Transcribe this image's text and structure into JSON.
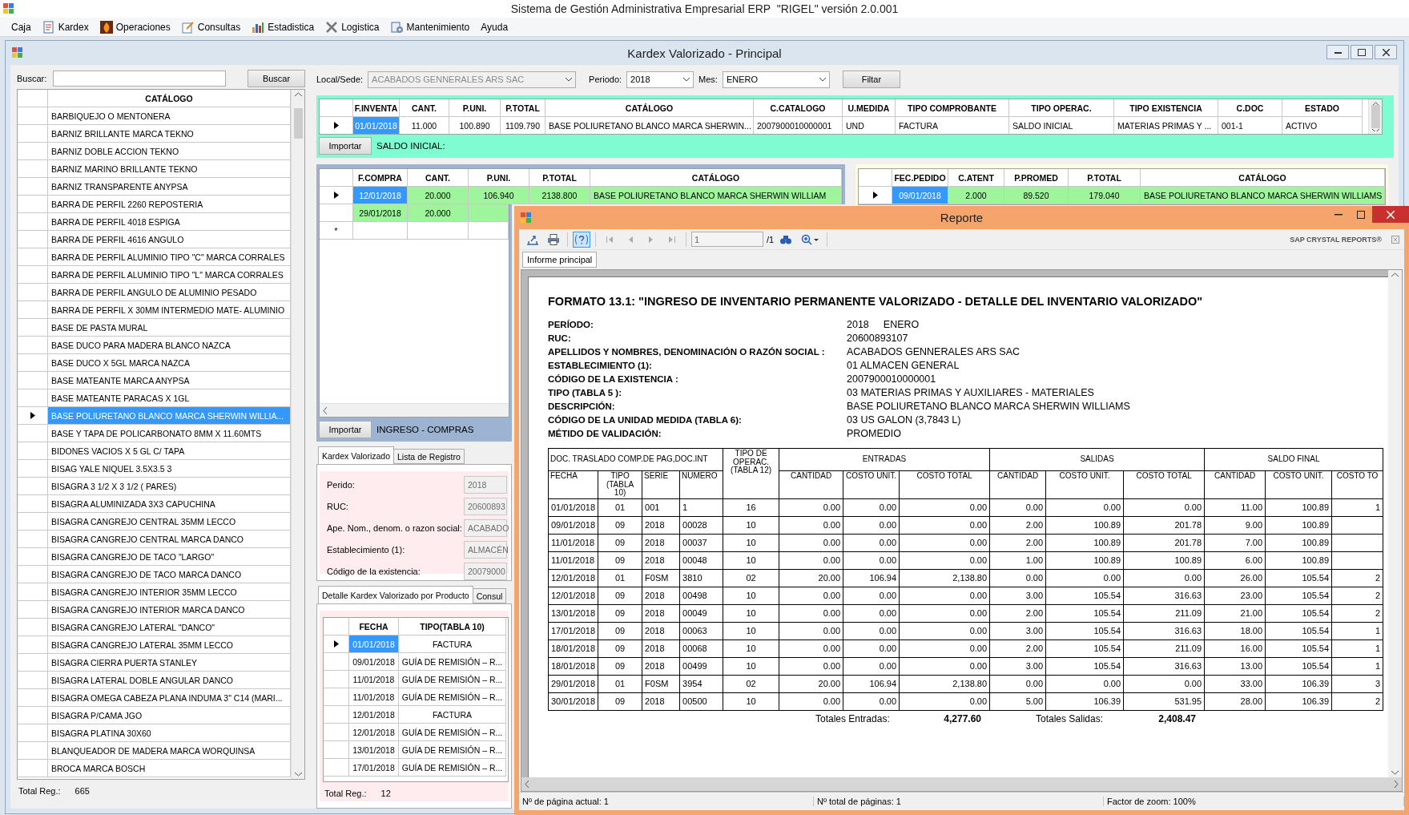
{
  "app_title": "Sistema de Gestión Administrativa Empresarial ERP  \"RIGEL\" versión 2.0.001",
  "menu": [
    {
      "label": "Caja",
      "has_icon": false
    },
    {
      "label": "Kardex",
      "has_icon": true
    },
    {
      "label": "Operaciones",
      "has_icon": true
    },
    {
      "label": "Consultas",
      "has_icon": true
    },
    {
      "label": "Estadistica",
      "has_icon": true
    },
    {
      "label": "Logistica",
      "has_icon": true
    },
    {
      "label": "Mantenimiento",
      "has_icon": true
    },
    {
      "label": "Ayuda",
      "has_icon": false
    }
  ],
  "kardex_window": {
    "title": "Kardex Valorizado - Principal"
  },
  "catalog_panel": {
    "search_label": "Buscar:",
    "search_button": "Buscar",
    "column": "CATÁLOGO",
    "total_label": "Total Reg.:",
    "total": "665",
    "items": [
      {
        "label": "BARBIQUEJO O MENTONERA",
        "selected": false
      },
      {
        "label": "BARNIZ BRILLANTE MARCA TEKNO",
        "selected": false
      },
      {
        "label": "BARNIZ DOBLE ACCION TEKNO",
        "selected": false
      },
      {
        "label": "BARNIZ MARINO BRILLANTE TEKNO",
        "selected": false
      },
      {
        "label": "BARNIZ TRANSPARENTE ANYPSA",
        "selected": false
      },
      {
        "label": "BARRA DE PERFIL 2260 REPOSTERIA",
        "selected": false
      },
      {
        "label": "BARRA DE PERFIL 4018 ESPIGA",
        "selected": false
      },
      {
        "label": "BARRA DE PERFIL 4616 ANGULO",
        "selected": false
      },
      {
        "label": "BARRA DE PERFIL ALUMINIO TIPO \"C\" MARCA CORRALES",
        "selected": false
      },
      {
        "label": "BARRA DE PERFIL ALUMINIO TIPO \"L\" MARCA CORRALES",
        "selected": false
      },
      {
        "label": "BARRA DE PERFIL ANGULO DE ALUMINIO PESADO",
        "selected": false
      },
      {
        "label": "BARRA DE PERFIL X 30MM INTERMEDIO MATE- ALUMINIO",
        "selected": false
      },
      {
        "label": "BASE DE PASTA MURAL",
        "selected": false
      },
      {
        "label": "BASE DUCO PARA MADERA BLANCO NAZCA",
        "selected": false
      },
      {
        "label": "BASE DUCO X 5GL MARCA NAZCA",
        "selected": false
      },
      {
        "label": "BASE MATEANTE MARCA ANYPSA",
        "selected": false
      },
      {
        "label": "BASE MATEANTE PARACAS X 1GL",
        "selected": false
      },
      {
        "label": "BASE POLIURETANO BLANCO MARCA SHERWIN WILLIA...",
        "selected": true
      },
      {
        "label": "BASE Y TAPA DE POLICARBONATO 8MM X 11.60MTS",
        "selected": false
      },
      {
        "label": "BIDONES VACIOS X 5 GL C/ TAPA",
        "selected": false
      },
      {
        "label": "BISAG YALE NIQUEL 3.5X3.5 3",
        "selected": false
      },
      {
        "label": "BISAGRA 3 1/2 X 3 1/2 ( PARES)",
        "selected": false
      },
      {
        "label": "BISAGRA ALUMINIZADA 3X3 CAPUCHINA",
        "selected": false
      },
      {
        "label": "BISAGRA CANGREJO CENTRAL 35MM LECCO",
        "selected": false
      },
      {
        "label": "BISAGRA CANGREJO CENTRAL MARCA DANCO",
        "selected": false
      },
      {
        "label": "BISAGRA CANGREJO DE TACO \"LARGO\"",
        "selected": false
      },
      {
        "label": "BISAGRA CANGREJO DE TACO MARCA DANCO",
        "selected": false
      },
      {
        "label": "BISAGRA CANGREJO INTERIOR 35MM LECCO",
        "selected": false
      },
      {
        "label": "BISAGRA CANGREJO INTERIOR MARCA DANCO",
        "selected": false
      },
      {
        "label": "BISAGRA CANGREJO LATERAL \"DANCO\"",
        "selected": false
      },
      {
        "label": "BISAGRA CANGREJO LATERAL 35MM LECCO",
        "selected": false
      },
      {
        "label": "BISAGRA CIERRA PUERTA STANLEY",
        "selected": false
      },
      {
        "label": "BISAGRA LATERAL DOBLE ANGULAR DANCO",
        "selected": false
      },
      {
        "label": "BISAGRA OMEGA CABEZA PLANA INDUMA 3\" C14 (MARI...",
        "selected": false
      },
      {
        "label": "BISAGRA P/CAMA JGO",
        "selected": false
      },
      {
        "label": "BISAGRA PLATINA 30X60",
        "selected": false
      },
      {
        "label": "BLANQUEADOR DE MADERA MARCA WORQUINSA",
        "selected": false
      },
      {
        "label": "BROCA  MARCA BOSCH",
        "selected": false
      }
    ]
  },
  "filters": {
    "local_label": "Local/Sede:",
    "local_value": "ACABADOS GENNERALES ARS SAC",
    "local_disabled": true,
    "period_label": "Periodo:",
    "period_value": "2018",
    "month_label": "Mes:",
    "month_value": "ENERO",
    "filter_button": "Filtar"
  },
  "saldo_inicial": {
    "columns": [
      "F.INVENTA",
      "CANT.",
      "P.UNI.",
      "P.TOTAL",
      "CATÁLOGO",
      "C.CATALOGO",
      "U.MEDIDA",
      "TIPO COMPROBANTE",
      "TIPO OPERAC.",
      "TIPO EXISTENCIA",
      "C.DOC",
      "ESTADO"
    ],
    "rows": [
      {
        "selected": true,
        "cells": [
          "01/01/2018",
          "11.000",
          "100.890",
          "1109.790",
          "BASE POLIURETANO BLANCO MARCA SHERWIN...",
          "2007900010000001",
          "UND",
          "FACTURA",
          "SALDO INICIAL",
          "MATERIAS PRIMAS Y ...",
          "001-1",
          "ACTIVO"
        ]
      }
    ],
    "import_button": "Importar",
    "caption": "SALDO INICIAL:"
  },
  "compras": {
    "columns": [
      "F.COMPRA",
      "CANT.",
      "P.UNI.",
      "P.TOTAL",
      "CATÁLOGO"
    ],
    "rows": [
      {
        "selected": true,
        "cells": [
          "12/01/2018",
          "20.000",
          "106.940",
          "2138.800",
          "BASE POLIURETANO BLANCO MARCA SHERWIN WILLIAM"
        ]
      },
      {
        "selected": false,
        "cells": [
          "29/01/2018",
          "20.000"
        ]
      }
    ],
    "new_row_marker": "*",
    "import_button": "Importar",
    "caption": "INGRESO - COMPRAS"
  },
  "pedidos": {
    "columns": [
      "FEC.PEDIDO",
      "C.ATENT",
      "P.PROMED",
      "P.TOTAL",
      "CATÁLOGO"
    ],
    "rows": [
      {
        "selected": true,
        "cells": [
          "09/01/2018",
          "2.000",
          "89.520",
          "179.040",
          "BASE POLIURETANO BLANCO MARCA SHERWIN WILLIAMS"
        ]
      }
    ]
  },
  "kardex_tabs": [
    {
      "label": "Kardex Valorizado",
      "selected": true
    },
    {
      "label": "Lista de Registro",
      "selected": false
    }
  ],
  "kardex_fields": [
    {
      "label": "Perido:",
      "value": "2018",
      "disabled": true
    },
    {
      "label": "RUC:",
      "value": "20600893",
      "disabled": true
    },
    {
      "label": "Ape.  Nom., denom. o razon social:",
      "value": "ACABADO",
      "disabled": true
    },
    {
      "label": "Establecimiento (1):",
      "value": "ALMACÉN",
      "disabled": true
    },
    {
      "label": "Código de la existencia:",
      "value": "20079000",
      "disabled": true
    }
  ],
  "detalle_tabs": [
    {
      "label": "Detalle Kardex Valorizado por Producto",
      "selected": true
    },
    {
      "label": "Consul",
      "selected": false
    }
  ],
  "detalle_grid": {
    "columns": [
      "FECHA",
      "TIPO(TABLA 10)"
    ],
    "rows": [
      {
        "selected": true,
        "cells": [
          "01/01/2018",
          "FACTURA"
        ]
      },
      {
        "selected": false,
        "cells": [
          "09/01/2018",
          "GUÍA DE REMISIÓN – R..."
        ]
      },
      {
        "selected": false,
        "cells": [
          "11/01/2018",
          "GUÍA DE REMISIÓN – R..."
        ]
      },
      {
        "selected": false,
        "cells": [
          "11/01/2018",
          "GUÍA DE REMISIÓN – R..."
        ]
      },
      {
        "selected": false,
        "cells": [
          "12/01/2018",
          "FACTURA"
        ]
      },
      {
        "selected": false,
        "cells": [
          "12/01/2018",
          "GUÍA DE REMISIÓN – R..."
        ]
      },
      {
        "selected": false,
        "cells": [
          "13/01/2018",
          "GUÍA DE REMISIÓN – R..."
        ]
      },
      {
        "selected": false,
        "cells": [
          "17/01/2018",
          "GUÍA DE REMISIÓN – R..."
        ]
      }
    ],
    "total_label": "Total Reg.:",
    "total": "12"
  },
  "report": {
    "title": "Reporte",
    "page_field": "1",
    "page_count": "/1",
    "brand": "SAP CRYSTAL REPORTS®",
    "help_active": true,
    "tab": "Informe principal",
    "heading": "FORMATO 13.1: \"INGRESO DE INVENTARIO PERMANENTE VALORIZADO - DETALLE DEL INVENTARIO VALORIZADO\"",
    "info": [
      {
        "label": "PERÍODO:",
        "values": [
          "2018",
          "ENERO"
        ]
      },
      {
        "label": "RUC:",
        "values": [
          "20600893107"
        ]
      },
      {
        "label": "APELLIDOS Y NOMBRES, DENOMINACIÓN O RAZÓN SOCIAL :",
        "values": [
          "ACABADOS GENNERALES ARS SAC"
        ]
      },
      {
        "label": "ESTABLECIMIENTO (1):",
        "values": [
          "01  ALMACEN GENERAL"
        ]
      },
      {
        "label": "CÓDIGO DE LA EXISTENCIA :",
        "values": [
          "2007900010000001"
        ]
      },
      {
        "label": "TIPO (TABLA 5 ):",
        "values": [
          "03  MATERIAS PRIMAS Y AUXILIARES - MATERIALES"
        ]
      },
      {
        "label": "DESCRIPCIÓN:",
        "values": [
          "BASE POLIURETANO BLANCO MARCA SHERWIN WILLIAMS"
        ]
      },
      {
        "label": "CÓDIGO DE LA UNIDAD MEDIDA (TABLA 6):",
        "values": [
          "03 US GALON (3,7843 L)"
        ]
      },
      {
        "label": "MÉTIDO DE VALIDACIÓN:",
        "values": [
          "PROMEDIO"
        ]
      }
    ],
    "table": {
      "doc_group": "DOC. TRASLADO COMP.DE PAG,DOC.INT",
      "groups": [
        "ENTRADAS",
        "SALIDAS",
        "SALDO FINAL"
      ],
      "columns": [
        "FECHA",
        "TIPO (TABLA 10)",
        "SERIE",
        "NUMERO",
        "TIPO DE OPERAC. (TABLA 12)",
        "CANTIDAD",
        "COSTO UNIT.",
        "COSTO TOTAL",
        "CANTIDAD",
        "COSTO UNIT.",
        "COSTO TOTAL",
        "CANTIDAD",
        "COSTO UNIT.",
        "COSTO TO"
      ],
      "rows": [
        [
          "01/01/2018",
          "01",
          "001",
          "1",
          "16",
          "0.00",
          "0.00",
          "0.00",
          "0.00",
          "0.00",
          "0.00",
          "11.00",
          "100.89",
          "1"
        ],
        [
          "09/01/2018",
          "09",
          "2018",
          "00028",
          "10",
          "0.00",
          "0.00",
          "0.00",
          "2.00",
          "100.89",
          "201.78",
          "9.00",
          "100.89"
        ],
        [
          "11/01/2018",
          "09",
          "2018",
          "00037",
          "10",
          "0.00",
          "0.00",
          "0.00",
          "2.00",
          "100.89",
          "201.78",
          "7.00",
          "100.89"
        ],
        [
          "11/01/2018",
          "09",
          "2018",
          "00048",
          "10",
          "0.00",
          "0.00",
          "0.00",
          "1.00",
          "100.89",
          "100.89",
          "6.00",
          "100.89"
        ],
        [
          "12/01/2018",
          "01",
          "F0SM",
          "3810",
          "02",
          "20.00",
          "106.94",
          "2,138.80",
          "0.00",
          "0.00",
          "0.00",
          "26.00",
          "105.54",
          "2"
        ],
        [
          "12/01/2018",
          "09",
          "2018",
          "00498",
          "10",
          "0.00",
          "0.00",
          "0.00",
          "3.00",
          "105.54",
          "316.63",
          "23.00",
          "105.54",
          "2"
        ],
        [
          "13/01/2018",
          "09",
          "2018",
          "00049",
          "10",
          "0.00",
          "0.00",
          "0.00",
          "2.00",
          "105.54",
          "211.09",
          "21.00",
          "105.54",
          "2"
        ],
        [
          "17/01/2018",
          "09",
          "2018",
          "00063",
          "10",
          "0.00",
          "0.00",
          "0.00",
          "3.00",
          "105.54",
          "316.63",
          "18.00",
          "105.54",
          "1"
        ],
        [
          "18/01/2018",
          "09",
          "2018",
          "00068",
          "10",
          "0.00",
          "0.00",
          "0.00",
          "2.00",
          "105.54",
          "211.09",
          "16.00",
          "105.54",
          "1"
        ],
        [
          "18/01/2018",
          "09",
          "2018",
          "00499",
          "10",
          "0.00",
          "0.00",
          "0.00",
          "3.00",
          "105.54",
          "316.63",
          "13.00",
          "105.54",
          "1"
        ],
        [
          "29/01/2018",
          "01",
          "F0SM",
          "3954",
          "02",
          "20.00",
          "106.94",
          "2,138.80",
          "0.00",
          "0.00",
          "0.00",
          "33.00",
          "106.39",
          "3"
        ],
        [
          "30/01/2018",
          "09",
          "2018",
          "00500",
          "10",
          "0.00",
          "0.00",
          "0.00",
          "5.00",
          "106.39",
          "531.95",
          "28.00",
          "106.39",
          "2"
        ]
      ],
      "totals": [
        {
          "label": "Totales Entradas:",
          "value": "4,277.60"
        },
        {
          "label": "Totales Salidas:",
          "value": "2,408.47"
        }
      ]
    },
    "status": [
      "Nº de página actual: 1",
      "Nº total de páginas: 1",
      "Factor de zoom: 100%"
    ]
  }
}
